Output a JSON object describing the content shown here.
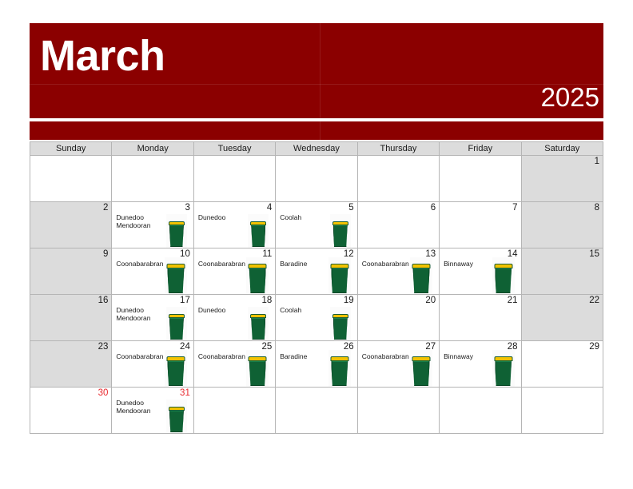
{
  "banner": {
    "month": "March",
    "year": "2025",
    "background_color": "#8b0000",
    "text_color": "#ffffff"
  },
  "calendar": {
    "weekday_headers": [
      "Sunday",
      "Monday",
      "Tuesday",
      "Wednesday",
      "Thursday",
      "Friday",
      "Saturday"
    ],
    "bin_icon": "waste-bin-icon",
    "bin_colors": {
      "lid": "#f2c200",
      "body": "#0f6134"
    },
    "shaded_color": "#dcdcdc",
    "red_day_color": "#e8272c",
    "weeks": [
      {
        "bin_size": "small",
        "days": [
          {
            "num": "",
            "text": "",
            "bin": false,
            "shaded": false
          },
          {
            "num": "",
            "text": "",
            "bin": false,
            "shaded": false
          },
          {
            "num": "",
            "text": "",
            "bin": false,
            "shaded": false
          },
          {
            "num": "",
            "text": "",
            "bin": false,
            "shaded": false
          },
          {
            "num": "",
            "text": "",
            "bin": false,
            "shaded": false
          },
          {
            "num": "",
            "text": "",
            "bin": false,
            "shaded": false
          },
          {
            "num": "1",
            "text": "",
            "bin": false,
            "shaded": true
          }
        ]
      },
      {
        "bin_size": "small",
        "days": [
          {
            "num": "2",
            "text": "",
            "bin": false,
            "shaded": true
          },
          {
            "num": "3",
            "text": "Dunedoo\nMendooran",
            "bin": true,
            "shaded": false
          },
          {
            "num": "4",
            "text": "Dunedoo",
            "bin": true,
            "shaded": false
          },
          {
            "num": "5",
            "text": "Coolah",
            "bin": true,
            "shaded": false
          },
          {
            "num": "6",
            "text": "",
            "bin": false,
            "shaded": false
          },
          {
            "num": "7",
            "text": "",
            "bin": false,
            "shaded": false
          },
          {
            "num": "8",
            "text": "",
            "bin": false,
            "shaded": true
          }
        ]
      },
      {
        "bin_size": "big",
        "days": [
          {
            "num": "9",
            "text": "",
            "bin": false,
            "shaded": true
          },
          {
            "num": "10",
            "text": "Coonabarabran",
            "bin": true,
            "shaded": false
          },
          {
            "num": "11",
            "text": "Coonabarabran",
            "bin": true,
            "shaded": false
          },
          {
            "num": "12",
            "text": "Baradine",
            "bin": true,
            "shaded": false
          },
          {
            "num": "13",
            "text": "Coonabarabran",
            "bin": true,
            "shaded": false
          },
          {
            "num": "14",
            "text": "Binnaway",
            "bin": true,
            "shaded": false
          },
          {
            "num": "15",
            "text": "",
            "bin": false,
            "shaded": true
          }
        ]
      },
      {
        "bin_size": "small",
        "days": [
          {
            "num": "16",
            "text": "",
            "bin": false,
            "shaded": true
          },
          {
            "num": "17",
            "text": "Dunedoo\nMendooran",
            "bin": true,
            "shaded": false
          },
          {
            "num": "18",
            "text": "Dunedoo",
            "bin": true,
            "shaded": false
          },
          {
            "num": "19",
            "text": "Coolah",
            "bin": true,
            "shaded": false
          },
          {
            "num": "20",
            "text": "",
            "bin": false,
            "shaded": false
          },
          {
            "num": "21",
            "text": "",
            "bin": false,
            "shaded": false
          },
          {
            "num": "22",
            "text": "",
            "bin": false,
            "shaded": true
          }
        ]
      },
      {
        "bin_size": "big",
        "days": [
          {
            "num": "23",
            "text": "",
            "bin": false,
            "shaded": true
          },
          {
            "num": "24",
            "text": "Coonabarabran",
            "bin": true,
            "shaded": false
          },
          {
            "num": "25",
            "text": "Coonabarabran",
            "bin": true,
            "shaded": false
          },
          {
            "num": "26",
            "text": "Baradine",
            "bin": true,
            "shaded": false
          },
          {
            "num": "27",
            "text": "Coonabarabran",
            "bin": true,
            "shaded": false
          },
          {
            "num": "28",
            "text": "Binnaway",
            "bin": true,
            "shaded": false
          },
          {
            "num": "29",
            "text": "",
            "bin": false,
            "shaded": false
          }
        ]
      },
      {
        "bin_size": "small",
        "days": [
          {
            "num": "30",
            "text": "",
            "bin": false,
            "shaded": false,
            "red": true
          },
          {
            "num": "31",
            "text": "Dunedoo\nMendooran",
            "bin": true,
            "shaded": false,
            "red": true
          },
          {
            "num": "",
            "text": "",
            "bin": false,
            "shaded": false
          },
          {
            "num": "",
            "text": "",
            "bin": false,
            "shaded": false
          },
          {
            "num": "",
            "text": "",
            "bin": false,
            "shaded": false
          },
          {
            "num": "",
            "text": "",
            "bin": false,
            "shaded": false
          },
          {
            "num": "",
            "text": "",
            "bin": false,
            "shaded": false
          }
        ]
      }
    ]
  }
}
